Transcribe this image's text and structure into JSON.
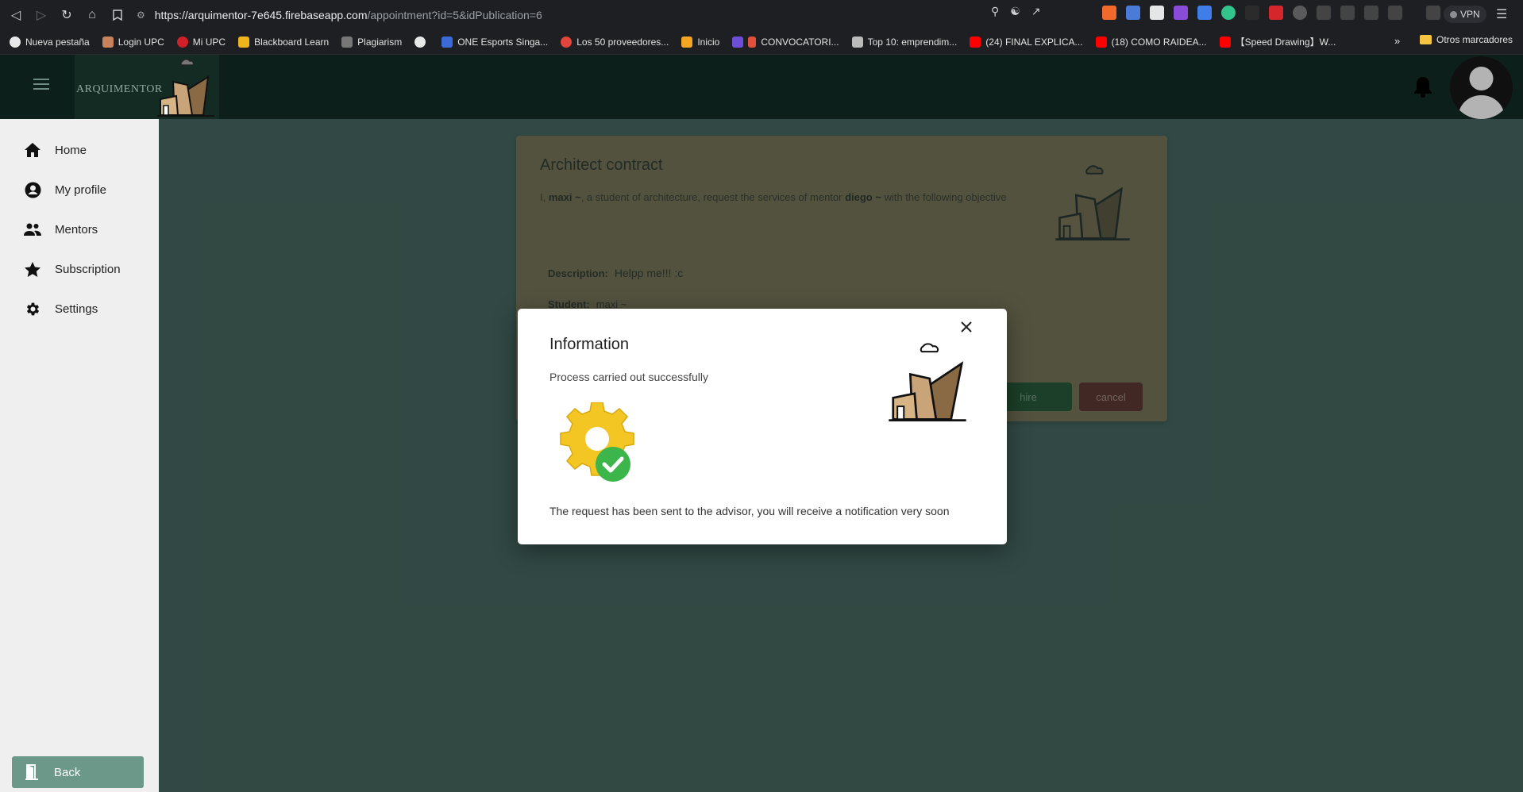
{
  "browser": {
    "url_host": "https://arquimentor-7e645.firebaseapp.com",
    "url_path": "/appointment?id=5&idPublication=6",
    "vpn_label": "VPN",
    "bookmarks": [
      "Nueva pestaña",
      "Login UPC",
      "Mi UPC",
      "Blackboard Learn",
      "Plagiarism",
      "",
      "ONE Esports Singa...",
      "Los 50 proveedores...",
      "Inicio",
      "CONVOCATORI...",
      "Top 10: emprendim...",
      "(24) FINAL EXPLICA...",
      "(18) COMO RAIDEA...",
      "【Speed Drawing】W..."
    ],
    "bookmarks_more": "»",
    "other_bookmarks": "Otros marcadores"
  },
  "header": {
    "brand": "ARQUIMENTOR"
  },
  "sidebar": {
    "items": [
      {
        "label": "Home",
        "icon": "home-icon"
      },
      {
        "label": "My profile",
        "icon": "account-circle-icon"
      },
      {
        "label": "Mentors",
        "icon": "people-icon"
      },
      {
        "label": "Subscription",
        "icon": "star-icon"
      },
      {
        "label": "Settings",
        "icon": "gear-icon"
      }
    ],
    "back_label": "Back"
  },
  "contract": {
    "title": "Architect contract",
    "text_prefix": "I, ",
    "student_name": "maxi ~",
    "text_middle": ", a student of architecture, request the services of mentor ",
    "mentor_name": "diego ~",
    "text_suffix": " with the following objective",
    "description_label": "Description:",
    "description_value": "Helpp me!!! :c",
    "student_label": "Student:",
    "student_value": "maxi ~",
    "hire_label": "hire",
    "cancel_label": "cancel"
  },
  "dialog": {
    "title": "Information",
    "message": "Process carried out successfully",
    "note": "The request has been sent to the advisor, you will receive a notification very soon"
  },
  "colors": {
    "header_bg": "#0d1f1a",
    "page_bg": "#3a5550",
    "card_bg": "#7e6846",
    "back_btn": "#6b9888",
    "hire_btn": "#0e4218",
    "cancel_btn": "#5a1512",
    "success_green": "#3cb54a",
    "gear_yellow": "#f3c623"
  }
}
